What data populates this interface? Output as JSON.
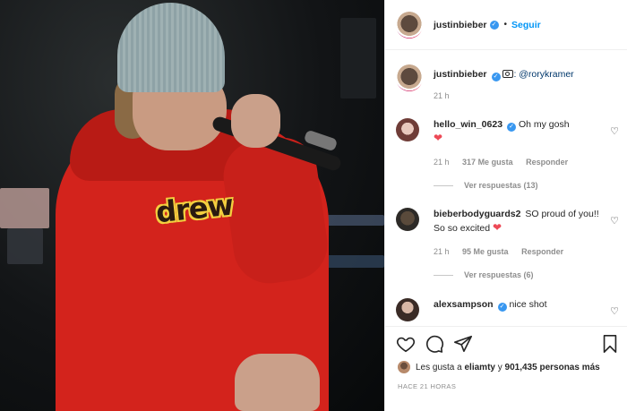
{
  "post": {
    "author": "justinbieber",
    "follow_label": "Seguir",
    "photo_print_text": "drew"
  },
  "caption": {
    "username": "justinbieber",
    "text": ": @rorykramer",
    "time": "21 h"
  },
  "comments": [
    {
      "username": "hello_win_0623",
      "verified": true,
      "text": "Oh my gosh",
      "emoji": "❤",
      "time": "21 h",
      "likes": "317 Me gusta",
      "reply_label": "Responder",
      "view_replies": "Ver respuestas (13)"
    },
    {
      "username": "bieberbodyguards2",
      "verified": false,
      "text": "SO proud of you!! So so excited",
      "emoji": "❤",
      "time": "21 h",
      "likes": "95 Me gusta",
      "reply_label": "Responder",
      "view_replies": "Ver respuestas (6)"
    },
    {
      "username": "alexsampson",
      "verified": true,
      "text": "nice shot"
    }
  ],
  "actions": {
    "liked_by_prefix": "Les gusta a",
    "liked_by_user": "eliamty",
    "liked_by_suffix": "y",
    "liked_by_count": "901,435 personas más",
    "timestamp": "HACE 21 HORAS"
  },
  "icons": {
    "verified": "verified-icon",
    "like": "heart-icon",
    "comment": "comment-icon",
    "share": "share-icon",
    "save": "bookmark-icon",
    "camera": "camera-icon"
  },
  "colors": {
    "accent": "#0095f6",
    "heart": "#ed4956",
    "hoodie": "#d3231c"
  }
}
